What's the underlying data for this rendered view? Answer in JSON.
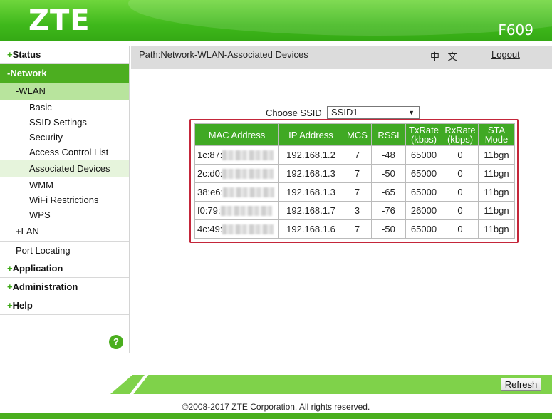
{
  "header": {
    "logo": "ZTE",
    "model": "F609"
  },
  "sidebar": {
    "status": {
      "sign": "+",
      "label": "Status"
    },
    "network": {
      "sign": "-",
      "label": "Network"
    },
    "wlan": {
      "label": "-WLAN"
    },
    "wlan_items": [
      "Basic",
      "SSID Settings",
      "Security",
      "Access Control List",
      "Associated Devices",
      "WMM",
      "WiFi Restrictions",
      "WPS"
    ],
    "lan": {
      "label": "+LAN"
    },
    "port_locating": "Port Locating",
    "application": {
      "sign": "+",
      "label": "Application"
    },
    "administration": {
      "sign": "+",
      "label": "Administration"
    },
    "help": {
      "sign": "+",
      "label": "Help"
    },
    "help_button": "?"
  },
  "pathbar": {
    "path": "Path:Network-WLAN-Associated Devices",
    "language": "中 文",
    "logout": "Logout"
  },
  "ssid": {
    "label": "Choose SSID",
    "selected": "SSID1"
  },
  "table": {
    "headers": {
      "mac": "MAC Address",
      "ip": "IP Address",
      "mcs": "MCS",
      "rssi": "RSSI",
      "txrate_1": "TxRate",
      "txrate_2": "(kbps)",
      "rxrate_1": "RxRate",
      "rxrate_2": "(kbps)",
      "sta_1": "STA",
      "sta_2": "Mode"
    },
    "rows": [
      {
        "mac": "1c:87:",
        "ip": "192.168.1.2",
        "mcs": "7",
        "rssi": "-48",
        "tx": "65000",
        "rx": "0",
        "mode": "11bgn"
      },
      {
        "mac": "2c:d0:",
        "ip": "192.168.1.3",
        "mcs": "7",
        "rssi": "-50",
        "tx": "65000",
        "rx": "0",
        "mode": "11bgn"
      },
      {
        "mac": "38:e6:",
        "ip": "192.168.1.3",
        "mcs": "7",
        "rssi": "-65",
        "tx": "65000",
        "rx": "0",
        "mode": "11bgn"
      },
      {
        "mac": "f0:79:",
        "ip": "192.168.1.7",
        "mcs": "3",
        "rssi": "-76",
        "tx": "26000",
        "rx": "0",
        "mode": "11bgn"
      },
      {
        "mac": "4c:49:",
        "ip": "192.168.1.6",
        "mcs": "7",
        "rssi": "-50",
        "tx": "65000",
        "rx": "0",
        "mode": "11bgn"
      }
    ]
  },
  "footer": {
    "refresh": "Refresh",
    "copyright": "©2008-2017 ZTE Corporation. All rights reserved."
  }
}
